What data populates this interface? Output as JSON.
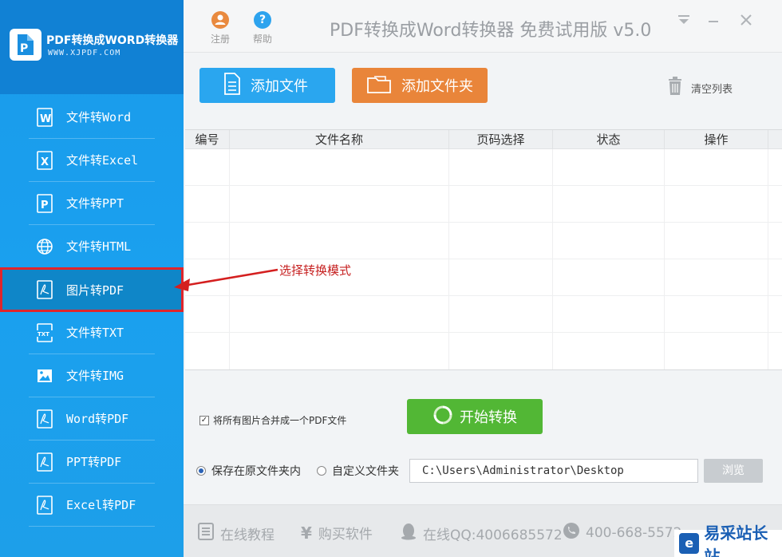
{
  "brand": {
    "title": "PDF转换成WORD转换器",
    "url": "WWW.XJPDF.COM"
  },
  "menu": [
    {
      "label": "文件转Word",
      "icon": "word-icon"
    },
    {
      "label": "文件转Excel",
      "icon": "excel-icon"
    },
    {
      "label": "文件转PPT",
      "icon": "ppt-icon"
    },
    {
      "label": "文件转HTML",
      "icon": "globe-icon"
    },
    {
      "label": "图片转PDF",
      "icon": "pdf-icon",
      "active": true
    },
    {
      "label": "文件转TXT",
      "icon": "txt-icon"
    },
    {
      "label": "文件转IMG",
      "icon": "image-icon"
    },
    {
      "label": "Word转PDF",
      "icon": "pdf-icon"
    },
    {
      "label": "PPT转PDF",
      "icon": "pdf-icon"
    },
    {
      "label": "Excel转PDF",
      "icon": "pdf-icon"
    }
  ],
  "topbar": {
    "register": "注册",
    "help": "帮助",
    "app_title": "PDF转换成Word转换器 免费试用版 v5.0"
  },
  "actions": {
    "add_file": "添加文件",
    "add_folder": "添加文件夹",
    "clear_list": "清空列表"
  },
  "table": {
    "headers": [
      "编号",
      "文件名称",
      "页码选择",
      "状态",
      "操作"
    ]
  },
  "annotation": "选择转换模式",
  "options": {
    "merge_label": "将所有图片合并成一个PDF文件",
    "merge_checked": true,
    "start_button": "开始转换",
    "save_original": "保存在原文件夹内",
    "custom_folder": "自定义文件夹",
    "output_path": "C:\\Users\\Administrator\\Desktop",
    "browse": "浏览"
  },
  "footer": {
    "tutorial": "在线教程",
    "buy": "购买软件",
    "qq": "在线QQ:4006685572",
    "phone": "400-668-5572"
  },
  "watermark": "易采站长站",
  "colors": {
    "sidebar": "#1a9bea",
    "add_file": "#2aa6ef",
    "add_folder": "#e9853a",
    "start": "#52b735",
    "annotation": "#c62020"
  }
}
